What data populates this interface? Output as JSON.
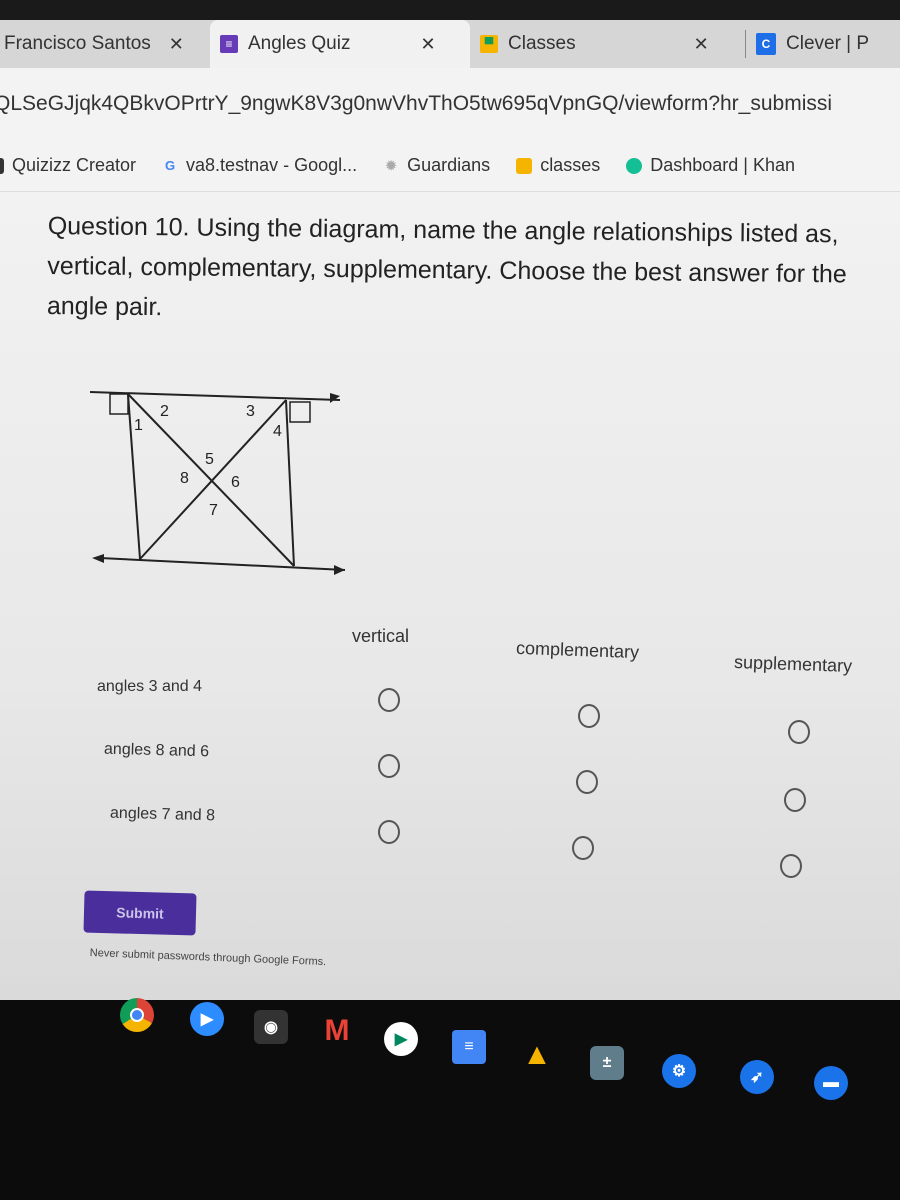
{
  "browser": {
    "tabs": [
      {
        "label": "Francisco Santos",
        "icon": "profile-tab",
        "active": false
      },
      {
        "label": "Angles Quiz",
        "icon": "google-forms-icon",
        "active": true
      },
      {
        "label": "Classes",
        "icon": "google-classroom-icon",
        "active": false
      },
      {
        "label": "Clever | P",
        "icon": "clever-icon",
        "active": false
      }
    ],
    "close_glyph": "✕",
    "url": "QLSeGJjqk4QBkvOPrtrY_9ngwK8V3g0nwVhvThO5tw695qVpnGQ/viewform?hr_submissi",
    "bookmarks": [
      {
        "label": "Quizizz Creator",
        "icon": "quizizz-icon"
      },
      {
        "label": "va8.testnav - Googl...",
        "icon": "google-icon",
        "glyph": "G"
      },
      {
        "label": "Guardians",
        "icon": "gear-icon",
        "glyph": "✹"
      },
      {
        "label": "classes",
        "icon": "google-classroom-icon"
      },
      {
        "label": "Dashboard | Khan",
        "icon": "khan-academy-icon"
      }
    ]
  },
  "form": {
    "question": "Question 10. Using the diagram, name the angle relationships listed as, vertical, complementary, supplementary. Choose the best answer for the angle pair.",
    "diagram_labels": [
      "1",
      "2",
      "3",
      "4",
      "5",
      "6",
      "7",
      "8"
    ],
    "columns": [
      "vertical",
      "complementary",
      "supplementary"
    ],
    "rows": [
      {
        "label": "angles 3 and 4",
        "selected": null
      },
      {
        "label": "angles 8 and 6",
        "selected": null
      },
      {
        "label": "angles 7 and 8",
        "selected": null
      }
    ],
    "submit_label": "Submit",
    "disclaimer": "Never submit passwords through Google Forms."
  },
  "shelf": {
    "apps": [
      "chrome-icon",
      "zoom-icon",
      "camera-icon",
      "gmail-icon",
      "play-store-icon",
      "google-docs-icon",
      "google-drive-icon",
      "calculator-icon",
      "settings-icon",
      "rocket-icon",
      "files-icon"
    ]
  }
}
